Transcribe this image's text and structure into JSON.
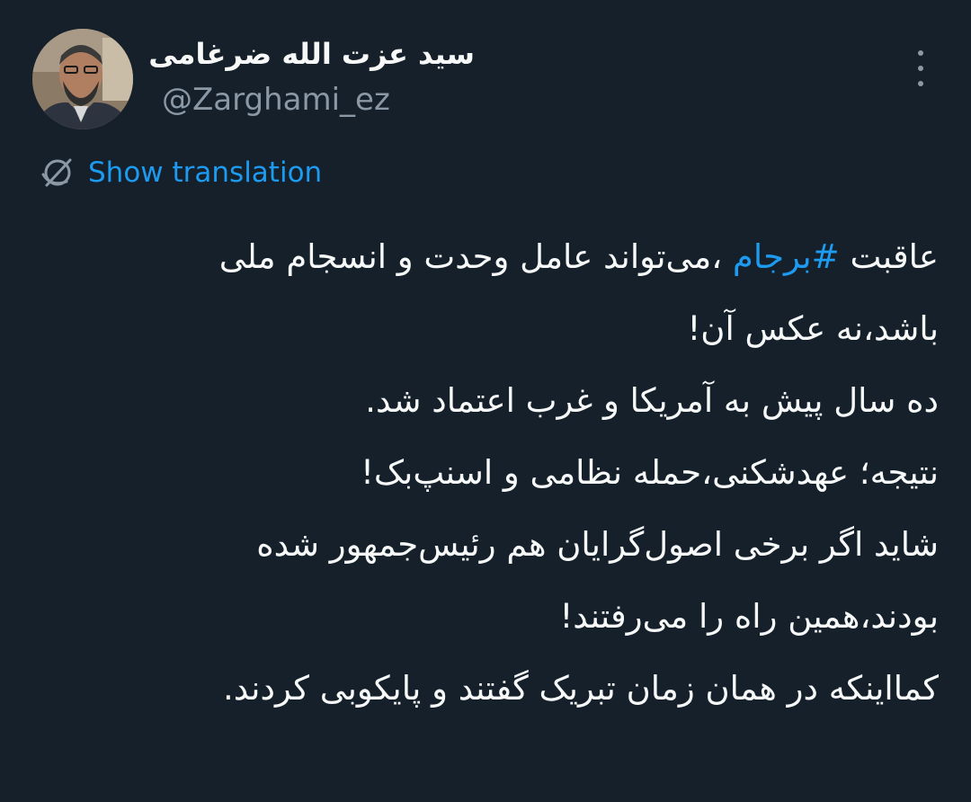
{
  "author": {
    "display_name": "سید عزت الله ضرغامی",
    "handle": "@Zarghami_ez",
    "avatar_icon": "profile-photo"
  },
  "menu": {
    "icon": "more-vertical-icon"
  },
  "translation": {
    "icon": "translate-globe-icon",
    "label": "Show translation"
  },
  "tweet": {
    "line1_prefix": "عاقبت",
    "hashtag": "#برجام",
    "line1_suffix": "،می‌تواند عامل وحدت و انسجام ملی",
    "lines": [
      "باشد،نه عکس آن!",
      "ده سال پیش به آمریکا و غرب اعتماد شد.",
      "نتیجه؛ عهدشکنی،حمله نظامی و اسنپ‌بک!",
      "شاید اگر برخی اصول‌گرایان هم رئیس‌جمهور شده",
      "بودند،همین راه را می‌رفتند!",
      "کمااینکه در همان زمان تبریک گفتند و پایکوبی کردند."
    ]
  },
  "colors": {
    "background": "#15202b",
    "text": "#f7f9f9",
    "secondary": "#8b98a5",
    "accent": "#1d9bf0"
  }
}
